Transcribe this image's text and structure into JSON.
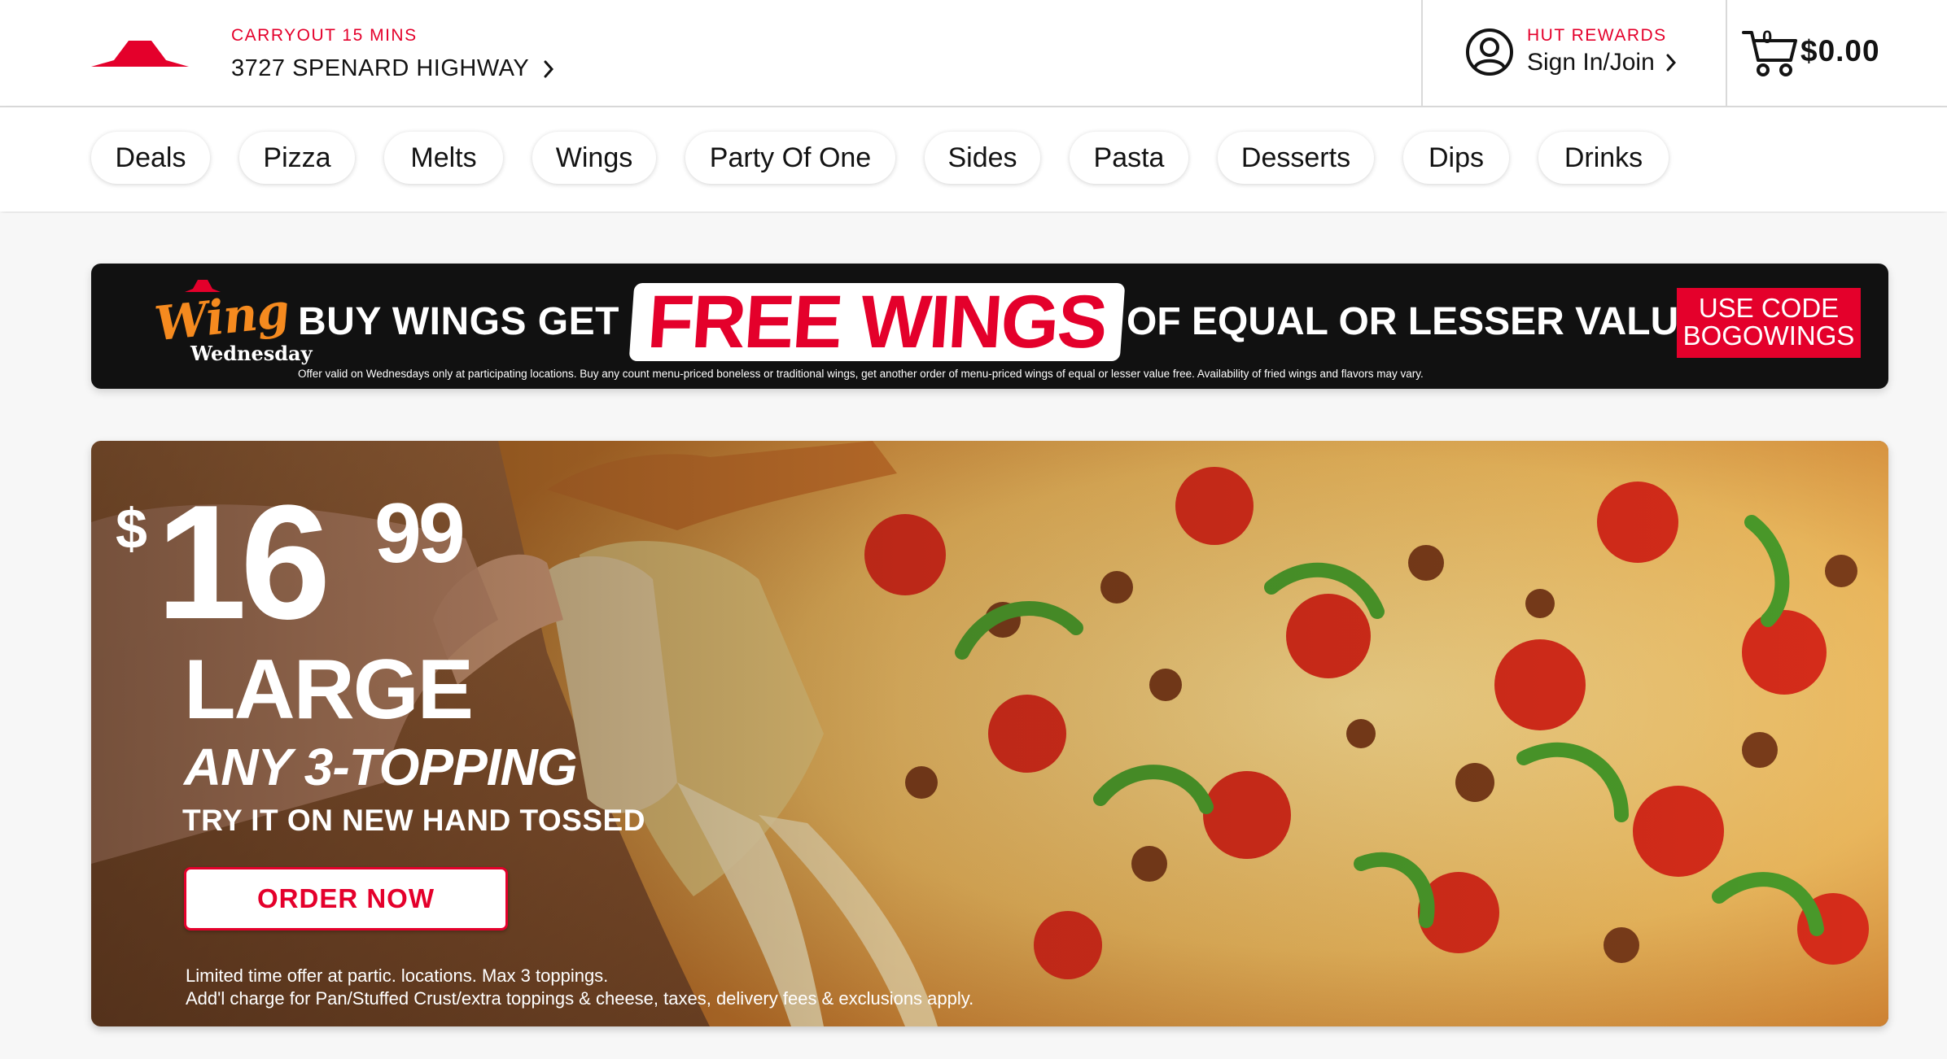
{
  "header": {
    "carryout_label": "CARRYOUT 15 MINS",
    "store_address": "3727 SPENARD HIGHWAY",
    "rewards_label": "HUT REWARDS",
    "signin_label": "Sign In/Join",
    "cart_count": "0",
    "cart_total": "$0.00"
  },
  "nav": {
    "categories": [
      "Deals",
      "Pizza",
      "Melts",
      "Wings",
      "Party Of One",
      "Sides",
      "Pasta",
      "Desserts",
      "Dips",
      "Drinks"
    ]
  },
  "wing_banner": {
    "logo_script": "Wing",
    "logo_sub": "Wednesday",
    "buy_text": "BUY WINGS GET",
    "free_text": "FREE WINGS",
    "equal_text": "OF EQUAL OR LESSER VALUE",
    "code_line1": "USE CODE",
    "code_line2": "BOGOWINGS",
    "fine_print": "Offer valid on Wednesdays only at participating locations. Buy any count menu-priced boneless or traditional wings, get another order of menu-priced wings of equal or lesser value free. Availability of fried wings and flavors may vary."
  },
  "hero": {
    "price_dollar": "$",
    "price_main": "16",
    "price_cents": "99",
    "size": "LARGE",
    "offer": "ANY 3-TOPPING",
    "tagline": "TRY IT ON NEW HAND TOSSED",
    "cta": "ORDER NOW",
    "fine_line1": "Limited time offer at partic. locations. Max 3 toppings.",
    "fine_line2": "Add'l charge for Pan/Stuffed Crust/extra toppings & cheese, taxes, delivery fees & exclusions apply."
  },
  "colors": {
    "brand_red": "#e4002b",
    "banner_black": "#111111",
    "wing_orange": "#f58a1f"
  },
  "icons": {
    "logo": "pizza-hut-roof-icon",
    "user": "user-circle-icon",
    "cart": "shopping-cart-icon",
    "chevron": "chevron-right-icon"
  }
}
